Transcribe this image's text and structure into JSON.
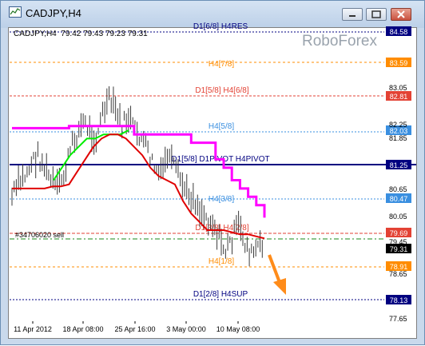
{
  "window": {
    "title": "CADJPY,H4"
  },
  "chart_header": {
    "symbol_tf": "CADJPY,H4",
    "ohlc": "79.42 79.43 79.23 79.31"
  },
  "watermark": "RoboForex",
  "order_label": "#34706020 sell",
  "colors": {
    "sup_res": "#000080",
    "murrey_orange": "#ff8c00",
    "murrey_red": "#e34234",
    "murrey_blue": "#3a8fe0",
    "price_line": "#3c3c3c",
    "magenta": "#ff00ff",
    "green": "#00ee00",
    "red_ma": "#e00000",
    "forecast_arrow": "#ff8c1a"
  },
  "levels": [
    {
      "label": "D1[6/8] H4RES",
      "price": "84.58",
      "color": "#000080"
    },
    {
      "label": "",
      "price": "83.59",
      "color": "#ff8c00"
    },
    {
      "label": "H4[7/8]",
      "price": "",
      "color": "#ff8c00"
    },
    {
      "label": "D1[5/8] H4[6/8]",
      "price": "82.81",
      "color": "#e34234"
    },
    {
      "label": "H4[5/8]",
      "price": "82.03",
      "color": "#3a8fe0"
    },
    {
      "label": "D1[5/8] D1PIVOT H4PIVOT",
      "price": "81.25",
      "color": "#000080"
    },
    {
      "label": "",
      "price": "80.47",
      "color": "#3a8fe0"
    },
    {
      "label": "H4[3/8]",
      "price": "",
      "color": "#3a8fe0"
    },
    {
      "label": "D1[3/8] H4[2/8]",
      "price": "79.69",
      "color": "#e34234"
    },
    {
      "label": "",
      "price": "79.31",
      "color": "#000000"
    },
    {
      "label": "H4[1/8]",
      "price": "78.91",
      "color": "#ff8c00"
    },
    {
      "label": "D1[2/8] H4SUP",
      "price": "78.13",
      "color": "#000080"
    }
  ],
  "chart_data": {
    "type": "line",
    "y_ticks": [
      "83.05",
      "82.25",
      "81.85",
      "80.65",
      "80.05",
      "79.45",
      "78.65",
      "77.65"
    ],
    "x_labels": [
      "11 Apr 2012",
      "18 Apr 08:00",
      "25 Apr 16:00",
      "3 May 00:00",
      "10 May 08:00"
    ],
    "ylim": [
      77.4,
      84.7
    ],
    "series": [
      {
        "values": [
          80.6,
          80.9,
          81.1,
          81.4,
          81.6,
          81.3,
          81.0,
          80.8,
          81.1,
          81.7,
          82.1,
          82.4,
          82.2,
          82.0,
          82.6,
          82.9,
          82.7,
          82.3,
          82.5,
          82.2,
          82.0,
          81.7,
          81.3,
          81.1,
          81.6,
          81.3,
          81.0,
          80.7,
          80.6,
          80.3,
          80.1,
          80.0,
          79.6,
          79.3,
          79.6,
          79.9,
          79.5,
          79.2,
          79.4,
          79.3
        ]
      },
      {
        "values": [
          82.25,
          82.25,
          82.25,
          82.25,
          82.25,
          82.25,
          82.25,
          82.3,
          82.3,
          82.3,
          82.3,
          82.3,
          82.3,
          82.3,
          82.3,
          82.1,
          82.1,
          82.1,
          82.1,
          82.1,
          82.1,
          82.1,
          81.9,
          81.9,
          81.9,
          81.5,
          81.3,
          81.0,
          80.8,
          80.6,
          80.4,
          80.1
        ]
      },
      {
        "values": [
          81.0,
          81.3,
          81.6,
          81.8,
          82.0,
          82.0,
          82.1,
          82.1,
          82.1,
          82.2
        ]
      },
      {
        "values": [
          80.8,
          80.8,
          80.8,
          80.8,
          80.8,
          80.85,
          80.85,
          80.9,
          81.2,
          81.5,
          81.8,
          82.0,
          82.1,
          82.1,
          82.0,
          81.8,
          81.6,
          81.3,
          81.1,
          81.0,
          80.9,
          80.5,
          80.2,
          80.0,
          79.8,
          79.8,
          79.8,
          79.75,
          79.7,
          79.7,
          79.65,
          79.6
        ]
      }
    ]
  }
}
